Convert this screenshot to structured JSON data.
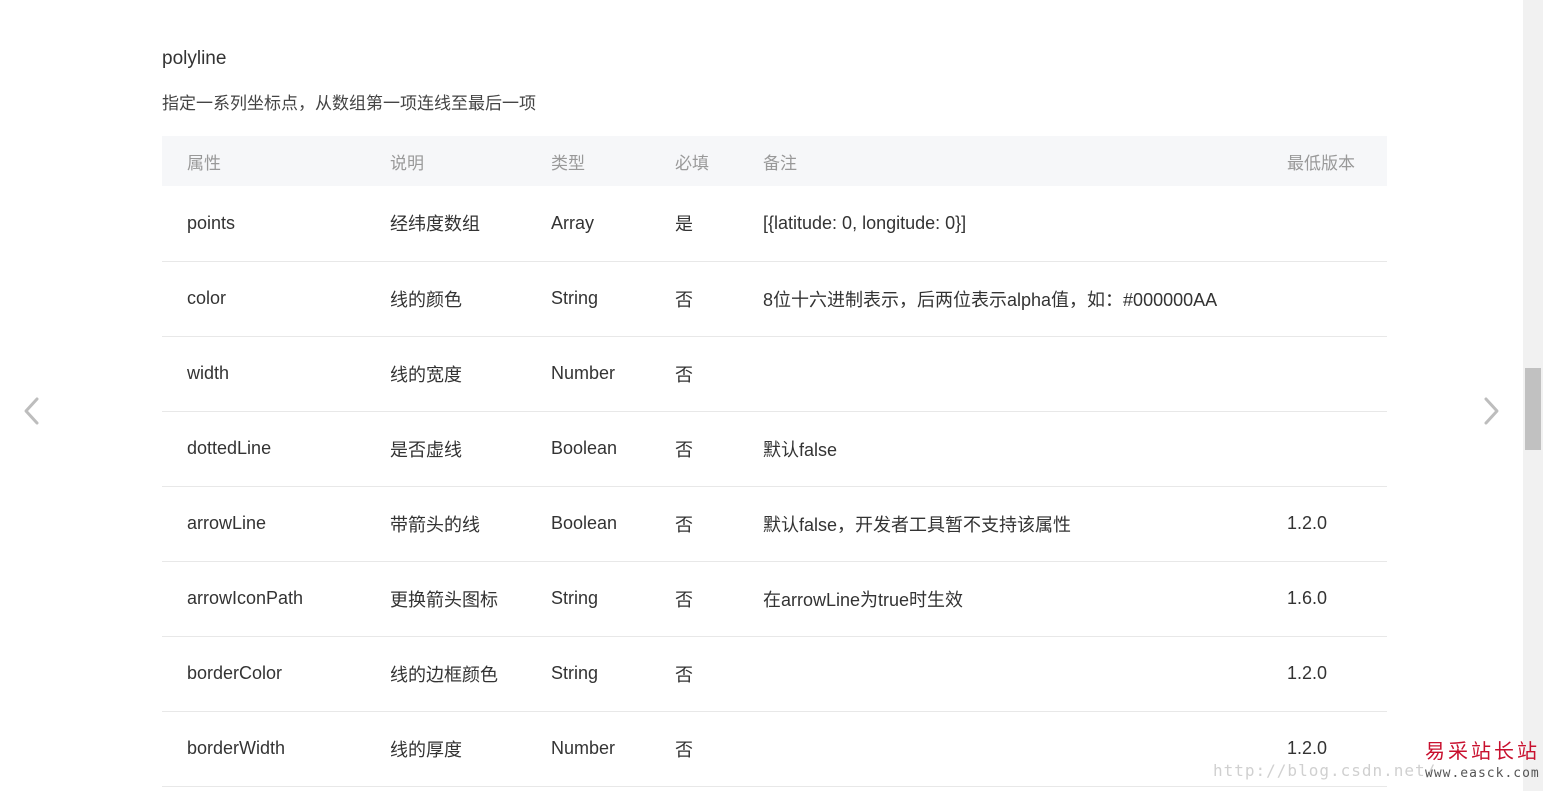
{
  "section": {
    "title": "polyline",
    "description": "指定一系列坐标点，从数组第一项连线至最后一项"
  },
  "table": {
    "headers": [
      "属性",
      "说明",
      "类型",
      "必填",
      "备注",
      "最低版本"
    ],
    "rows": [
      [
        "points",
        "经纬度数组",
        "Array",
        "是",
        "[{latitude: 0, longitude: 0}]",
        ""
      ],
      [
        "color",
        "线的颜色",
        "String",
        "否",
        "8位十六进制表示，后两位表示alpha值，如：#000000AA",
        ""
      ],
      [
        "width",
        "线的宽度",
        "Number",
        "否",
        "",
        ""
      ],
      [
        "dottedLine",
        "是否虚线",
        "Boolean",
        "否",
        "默认false",
        ""
      ],
      [
        "arrowLine",
        "带箭头的线",
        "Boolean",
        "否",
        "默认false，开发者工具暂不支持该属性",
        "1.2.0"
      ],
      [
        "arrowIconPath",
        "更换箭头图标",
        "String",
        "否",
        "在arrowLine为true时生效",
        "1.6.0"
      ],
      [
        "borderColor",
        "线的边框颜色",
        "String",
        "否",
        "",
        "1.2.0"
      ],
      [
        "borderWidth",
        "线的厚度",
        "Number",
        "否",
        "",
        "1.2.0"
      ]
    ]
  },
  "navigation": {
    "prev_icon": "chevron-left-icon",
    "next_icon": "chevron-right-icon"
  },
  "watermark": {
    "url": "http://blog.csdn.net/",
    "brand": "易采站长站",
    "site": "www.easck.com"
  },
  "colors": {
    "header_bg": "#f6f7f9",
    "version_link": "#4a7bb5",
    "row_border": "#e8e8e8",
    "watermark_brand": "#c8102e"
  }
}
